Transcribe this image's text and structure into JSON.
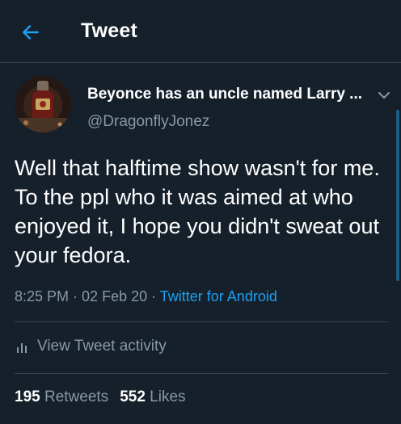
{
  "header": {
    "title": "Tweet",
    "back_icon": "arrow-left-icon"
  },
  "tweet": {
    "author_name": "Beyonce has an uncle named Larry ...",
    "author_handle": "@DragonflyJonez",
    "text": "Well that halftime show wasn't for me. To the ppl who it was aimed at who enjoyed it, I hope you didn't sweat out your fedora.",
    "time": "8:25 PM",
    "separator": " · ",
    "date": "02 Feb 20",
    "source": "Twitter for Android",
    "activity_label": "View Tweet activity",
    "retweets_count": "195",
    "retweets_label": "Retweets",
    "likes_count": "552",
    "likes_label": "Likes"
  },
  "colors": {
    "background": "#15202b",
    "accent": "#1da1f2",
    "secondary_text": "#8899a6",
    "divider": "#38444d"
  }
}
